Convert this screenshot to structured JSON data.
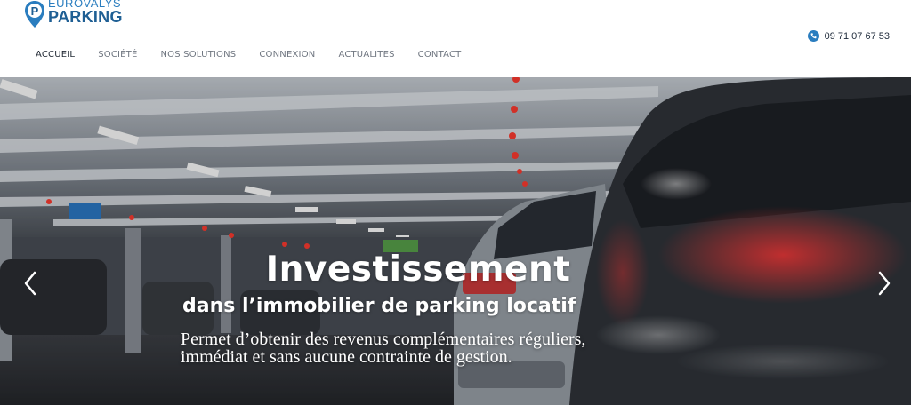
{
  "brand": {
    "logo_top": "EUROVALYS",
    "logo_bottom": "PARKING",
    "icon": "map-pin-p-icon",
    "color_primary": "#1f5f94",
    "color_accent": "#2a7dbf"
  },
  "contact": {
    "icon": "phone-icon",
    "phone": "09 71 07 67 53"
  },
  "nav": {
    "items": [
      {
        "label": "ACCUEIL",
        "active": true
      },
      {
        "label": "SOCIÉTÉ",
        "active": false
      },
      {
        "label": "NOS SOLUTIONS",
        "active": false
      },
      {
        "label": "CONNEXION",
        "active": false
      },
      {
        "label": "ACTUALITES",
        "active": false
      },
      {
        "label": "CONTACT",
        "active": false
      }
    ]
  },
  "hero": {
    "title": "Investissement",
    "subtitle": "dans l’immobilier de parking locatif",
    "text": "Permet d’obtenir des revenus complémentaires réguliers, immédiat et sans aucune contrainte de gestion.",
    "prev_icon": "chevron-left-icon",
    "next_icon": "chevron-right-icon"
  }
}
